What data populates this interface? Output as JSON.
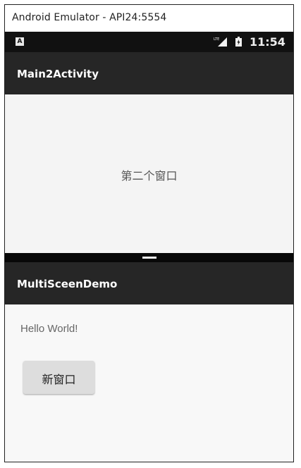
{
  "window": {
    "title": "Android Emulator - API24:5554"
  },
  "status_bar": {
    "notification_icon": "A",
    "signal_icon": "lte-signal-icon",
    "battery_icon": "battery-icon",
    "time": "11:54"
  },
  "top_activity": {
    "title": "Main2Activity",
    "content_text": "第二个窗口"
  },
  "split_divider": {
    "handle_icon": "split-handle-icon"
  },
  "bottom_activity": {
    "title": "MultiSceenDemo",
    "hello_text": "Hello World!",
    "button_label": "新窗口"
  },
  "colors": {
    "app_bar": "#262626",
    "status_bar": "#111111",
    "background": "#f4f4f4",
    "button": "#dddddd"
  }
}
